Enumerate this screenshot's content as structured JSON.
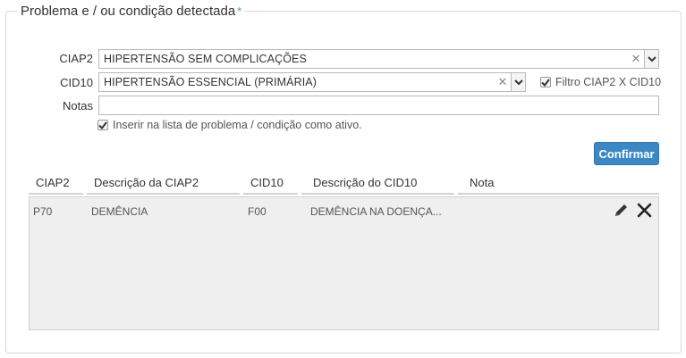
{
  "section": {
    "title": "Problema e / ou condição detectada",
    "required_marker": "*"
  },
  "form": {
    "ciap2": {
      "label": "CIAP2",
      "value": "HIPERTENSÃO SEM COMPLICAÇÕES"
    },
    "cid10": {
      "label": "CID10",
      "value": "HIPERTENSÃO ESSENCIAL (PRIMÁRIA)"
    },
    "filter": {
      "label": "Filtro CIAP2 X CID10",
      "checked": true
    },
    "notes": {
      "label": "Notas",
      "value": ""
    },
    "active": {
      "label": "Inserir na lista de problema / condição como ativo.",
      "checked": true
    },
    "confirm_label": "Confirmar"
  },
  "table": {
    "columns": [
      "CIAP2",
      "Descrição da CIAP2",
      "CID10",
      "Descrição do CID10",
      "Nota"
    ],
    "rows": [
      {
        "ciap2": "P70",
        "desc_ciap2": "DEMÊNCIA",
        "cid10": "F00",
        "desc_cid10": "DEMÊNCIA NA DOENÇA...",
        "nota": ""
      }
    ]
  },
  "colors": {
    "accent": "#3b88c5",
    "required": "#3a9bd8",
    "grid_background": "#efefef"
  },
  "icons": [
    "clear-icon",
    "chevron-down-icon",
    "checkmark-icon",
    "pencil-icon",
    "close-icon"
  ]
}
